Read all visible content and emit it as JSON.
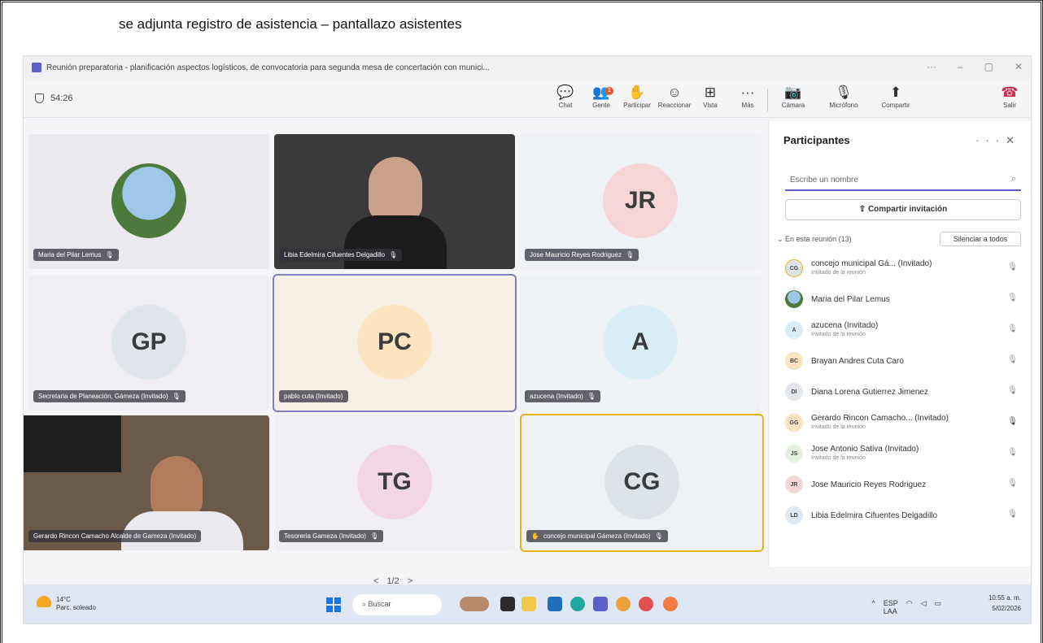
{
  "caption": "se adjunta registro de asistencia – pantallazo asistentes",
  "window": {
    "title": "Reunión preparatoria - planificación aspectos logísticos, de convocatoria para segunda mesa de concertación con munici..."
  },
  "toolbar": {
    "timer": "54:26",
    "buttons": [
      "Chat",
      "Gente",
      "Participar",
      "Reaccionar",
      "Vista",
      "Más",
      "Cámara",
      "Micrófono",
      "Compartir",
      "Salir"
    ],
    "people_badge": "1"
  },
  "tiles": [
    {
      "name": "Maria del Pilar Lemus",
      "initials": "",
      "type": "photo",
      "bg": "#ece8ef"
    },
    {
      "name": "Libia Edelmira Cifuentes Delgadillo",
      "initials": "",
      "type": "video",
      "bg": "#3a3a3a"
    },
    {
      "name": "Jose Mauricio Reyes Rodriguez",
      "initials": "JR",
      "type": "avatar",
      "bg": "#eef1f5",
      "color": "#f6d5d7"
    },
    {
      "name": "Secretaria de Planeación, Gámeza (Invitado)",
      "initials": "GP",
      "type": "avatar",
      "bg": "#eeedf2",
      "color": "#dfe5ea"
    },
    {
      "name": "pablo cuta (Invitado)",
      "initials": "PC",
      "type": "avatar",
      "bg": "#f6efe6",
      "color": "#fbe4bf"
    },
    {
      "name": "azucena (Invitado)",
      "initials": "A",
      "type": "avatar",
      "bg": "#eef2f4",
      "color": "#d9eef4"
    },
    {
      "name": "Gerardo Rincon Camacho Alcalde de Gameza (Invitado)",
      "initials": "",
      "type": "video",
      "bg": "#6b5a4a"
    },
    {
      "name": "Tesoreria Gameza (Invitado)",
      "initials": "TG",
      "type": "avatar",
      "bg": "#f1eef3",
      "color": "#f2d6e3"
    },
    {
      "name": "concejo municipal Gámeza (Invitado)",
      "initials": "CG",
      "type": "avatar",
      "bg": "#eef1f4",
      "color": "#dce4ea"
    }
  ],
  "pager": {
    "prev": "<",
    "text": "1/2",
    "next": ">"
  },
  "panel": {
    "title": "Participantes",
    "search_placeholder": "Escribe un nombre",
    "share_label": "Compartir invitación",
    "section_label": "En esta reunión (13)",
    "mute_all": "Silenciar a todos",
    "participants": [
      {
        "initials": "CG",
        "name": "concejo municipal Gá... (Invitado)",
        "sub": "Invitado de la reunión",
        "color": "#dce4ea"
      },
      {
        "initials": "",
        "name": "Maria del Pilar Lemus",
        "sub": "",
        "color": "#7ba3c5"
      },
      {
        "initials": "A",
        "name": "azucena (Invitado)",
        "sub": "Invitado de la reunión",
        "color": "#d9eef4"
      },
      {
        "initials": "BC",
        "name": "Brayan Andres Cuta Caro",
        "sub": "",
        "color": "#fbe4bf"
      },
      {
        "initials": "DI",
        "name": "Diana Lorena Gutierrez Jimenez",
        "sub": "",
        "color": "#e3e6ea"
      },
      {
        "initials": "GG",
        "name": "Gerardo Rincon Camacho... (Invitado)",
        "sub": "Invitado de la reunión",
        "color": "#fde3c0"
      },
      {
        "initials": "JS",
        "name": "Jose Antonio Sativa (Invitado)",
        "sub": "Invitado de la reunión",
        "color": "#e4f0e0"
      },
      {
        "initials": "JR",
        "name": "Jose Mauricio Reyes Rodriguez",
        "sub": "",
        "color": "#f6d5d7"
      },
      {
        "initials": "LD",
        "name": "Libia Edelmira Cifuentes Delgadillo",
        "sub": "",
        "color": "#dfe9f3"
      }
    ]
  },
  "taskbar": {
    "weather_temp": "14°C",
    "weather_desc": "Parc. soleado",
    "search": "Buscar",
    "lang": "ESP",
    "lang2": "LAA",
    "time": "10:55 a. m.",
    "date": "5/02/2026"
  }
}
